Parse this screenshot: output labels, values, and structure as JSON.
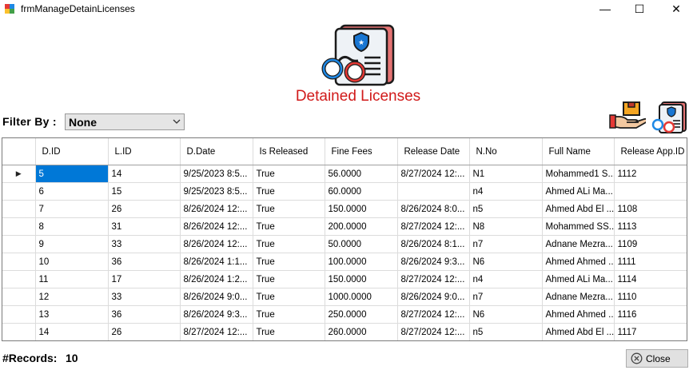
{
  "window": {
    "title": "frmManageDetainLicenses",
    "minimize_glyph": "—",
    "maximize_glyph": "☐",
    "close_glyph": "✕"
  },
  "header": {
    "title": "Detained Licenses",
    "title_color": "#d11a1a",
    "logo_icon": "detained-license-icon"
  },
  "filter": {
    "label": "Filter By :",
    "selected": "None"
  },
  "actions": {
    "release_icon": "release-license-icon",
    "detain_icon": "detain-license-icon"
  },
  "grid": {
    "columns": [
      "D.ID",
      "L.ID",
      "D.Date",
      "Is Released",
      "Fine Fees",
      "Release Date",
      "N.No",
      "Full Name",
      "Release App.ID"
    ],
    "current_row_marker": "▶",
    "selected_cell": {
      "row": 0,
      "col": 0
    },
    "rows": [
      [
        "5",
        "14",
        "9/25/2023 8:5...",
        "True",
        "56.0000",
        "8/27/2024 12:...",
        "N1",
        "Mohammed1 S...",
        "1112"
      ],
      [
        "6",
        "15",
        "9/25/2023 8:5...",
        "True",
        "60.0000",
        "",
        "n4",
        "Ahmed ALi Ma...",
        ""
      ],
      [
        "7",
        "26",
        "8/26/2024 12:...",
        "True",
        "150.0000",
        "8/26/2024 8:0...",
        "n5",
        "Ahmed Abd  El ...",
        "1108"
      ],
      [
        "8",
        "31",
        "8/26/2024 12:...",
        "True",
        "200.0000",
        "8/27/2024 12:...",
        "N8",
        "Mohammed SS...",
        "1113"
      ],
      [
        "9",
        "33",
        "8/26/2024 12:...",
        "True",
        "50.0000",
        "8/26/2024 8:1...",
        "n7",
        "Adnane Mezra...",
        "1109"
      ],
      [
        "10",
        "36",
        "8/26/2024 1:1...",
        "True",
        "100.0000",
        "8/26/2024 9:3...",
        "N6",
        "Ahmed Ahmed ...",
        "1111"
      ],
      [
        "11",
        "17",
        "8/26/2024 1:2...",
        "True",
        "150.0000",
        "8/27/2024 12:...",
        "n4",
        "Ahmed ALi Ma...",
        "1114"
      ],
      [
        "12",
        "33",
        "8/26/2024 9:0...",
        "True",
        "1000.0000",
        "8/26/2024 9:0...",
        "n7",
        "Adnane Mezra...",
        "1110"
      ],
      [
        "13",
        "36",
        "8/26/2024 9:3...",
        "True",
        "250.0000",
        "8/27/2024 12:...",
        "N6",
        "Ahmed Ahmed ...",
        "1116"
      ],
      [
        "14",
        "26",
        "8/27/2024 12:...",
        "True",
        "260.0000",
        "8/27/2024 12:...",
        "n5",
        "Ahmed Abd  El ...",
        "1117"
      ]
    ]
  },
  "footer": {
    "records_label": "#Records:",
    "records_count": "10",
    "close_label": "Close"
  }
}
